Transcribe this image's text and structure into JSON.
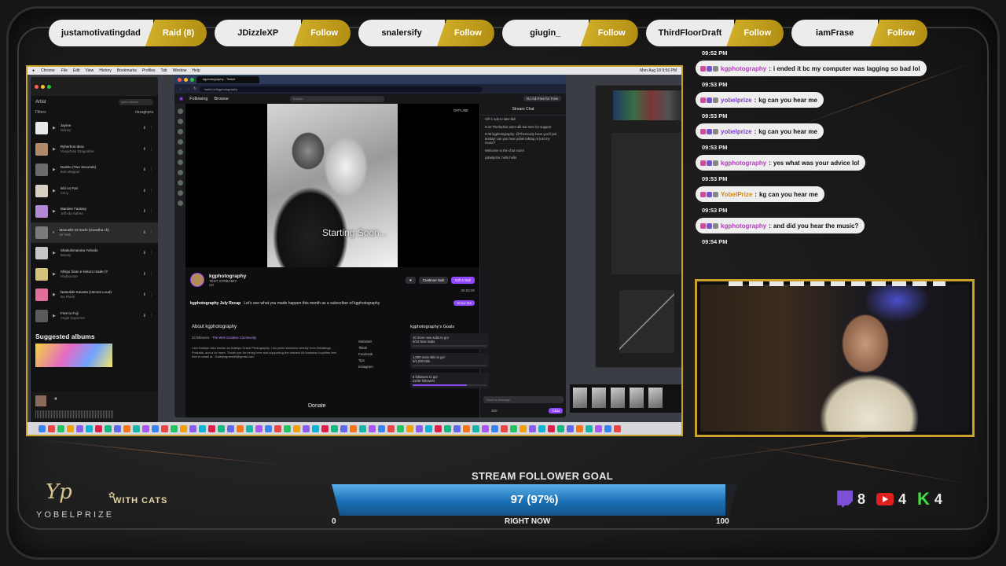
{
  "alerts": [
    {
      "name": "justamotivatingdad",
      "action": "Raid (8)"
    },
    {
      "name": "JDizzleXP",
      "action": "Follow"
    },
    {
      "name": "snalersify",
      "action": "Follow"
    },
    {
      "name": "giugin_",
      "action": "Follow"
    },
    {
      "name": "ThirdFloorDraft",
      "action": "Follow"
    },
    {
      "name": "iamFrase",
      "action": "Follow"
    }
  ],
  "desktop": {
    "menubar": {
      "app": "Chrome",
      "items": [
        "File",
        "Edit",
        "View",
        "History",
        "Bookmarks",
        "Profiles",
        "Tab",
        "Window",
        "Help"
      ],
      "clock": "Mon Aug 18 9:56 PM"
    },
    "music": {
      "section": "Artist",
      "search_placeholder": "open search",
      "filters_label": "Filters",
      "account": "nkzagkpra",
      "tracks": [
        {
          "title": "Jayme",
          "artist": "Money"
        },
        {
          "title": "Ryherhos-dera",
          "artist": "Youpclass Dragonfire"
        },
        {
          "title": "Daisho (Two Seconds)",
          "artist": "Bob Wapper"
        },
        {
          "title": "Ishi no Fari",
          "artist": "Ancy"
        },
        {
          "title": "Mantine Fantasy",
          "artist": "Jeff Ida Sahne"
        },
        {
          "title": "Manuelle M Hachi (Gosetha ch)",
          "artist": "Mr Meli"
        },
        {
          "title": "Shakuhimaruka Yuhodo",
          "artist": "Money"
        },
        {
          "title": "Shiigo futari e kokoro made (Y",
          "artist": "Hadaorose"
        },
        {
          "title": "Natsukite Kaiseta (Heroes Loud)",
          "artist": "No Plush"
        },
        {
          "title": "Free to Fuji",
          "artist": "Angel Supreme"
        }
      ],
      "suggested_label": "Suggested albums"
    },
    "browser": {
      "tab": "kgphotography - Twitch",
      "url": "twitch.tv/kgphotography",
      "nav": {
        "following": "Following",
        "browse": "Browse",
        "search": "Search",
        "ad": "Go Ad-Free for Free"
      },
      "offline": "OFFLINE",
      "starting": "Starting Soon...",
      "channel": {
        "name": "kgphotography",
        "title": "TEST STREAM!!!",
        "category": "Art",
        "continue_sub": "Continue Sub",
        "gift": "Gift a Sub",
        "timer": "00:00:00"
      },
      "recap": {
        "title": "kgphotography July Recap",
        "text": "Let's see what you made happen this month as a subscriber of kgphotography",
        "button": "Show Me"
      },
      "about": {
        "heading": "About kgphotography",
        "followers": "23 followers",
        "community": "The Web Creative Community",
        "bio": "I am Katelyn also known as Katelyn Grace Photography. I do photo sessions weekly from Weddings, Portraits, and a lot more. Thank you for being here and supporting the stream! All business inquiries feel free to email at : Katelyngracekit@gmail.com",
        "links": [
          "Website!!",
          "Tiktok",
          "Facebook",
          "Tips",
          "Instagram"
        ]
      },
      "goals": {
        "heading": "kgphotography's Goals",
        "items": [
          {
            "text": "10 more new subs to go!",
            "sub": "0/10 New Subs",
            "progress": 0
          },
          {
            "text": "1,000 more Bits to go!",
            "sub": "0/1,000 Bits",
            "progress": 0
          },
          {
            "text": "8 followers to go!",
            "sub": "22/30 followers",
            "progress": 0.73
          }
        ]
      },
      "donate": "Donate",
      "chat": {
        "title": "Stream Chat",
        "lines": [
          "Gift 1 sub to take fail!",
          "9:42 Therkezkie went afk but here for support",
          "9:45 kgphotography: @Theriously have you'll just testing! can you hear yobel talking or just my music?",
          "Welcome to the chat room!",
          "yobelprize: hello hello"
        ],
        "send_placeholder": "Send a message",
        "points": "300",
        "chat_button": "Chat"
      }
    }
  },
  "chat": [
    {
      "time": "09:52 PM",
      "user": "kgphotography",
      "text": "i ended it bc my computer was lagging so bad lol",
      "color": "#b23cbf"
    },
    {
      "time": "09:53 PM",
      "user": "yobelprize",
      "text": "kg can you hear me",
      "color": "#7b3fc9"
    },
    {
      "time": "09:53 PM",
      "user": "yobelprize",
      "text": "kg can you hear me",
      "color": "#7b3fc9"
    },
    {
      "time": "09:53 PM",
      "user": "kgphotography",
      "text": "yes what was your advice lol",
      "color": "#b23cbf"
    },
    {
      "time": "09:53 PM",
      "user": "YobelPrize",
      "text": "kg can you hear me",
      "color": "#d6831c"
    },
    {
      "time": "09:53 PM",
      "user": "kgphotography",
      "text": "and did you hear the music?",
      "color": "#b23cbf"
    },
    {
      "time": "09:54 PM",
      "user": "",
      "text": "",
      "color": ""
    }
  ],
  "follower_goal": {
    "title": "STREAM FOLLOWER GOAL",
    "value_text": "97 (97%)",
    "current": 97,
    "target": 100,
    "min_label": "0",
    "max_label": "100",
    "sub_label": "RIGHT NOW"
  },
  "logo": {
    "name": "YOBELPRIZE",
    "tagline": "WITH CATS"
  },
  "socials": [
    {
      "platform": "twitch-icon",
      "count": "8"
    },
    {
      "platform": "youtube-icon",
      "count": "4"
    },
    {
      "platform": "kick-icon",
      "count": "4"
    }
  ],
  "colors": {
    "accent_gold": "#c9a227",
    "goal_blue": "#1a6fb4",
    "twitch_purple": "#9147ff"
  }
}
